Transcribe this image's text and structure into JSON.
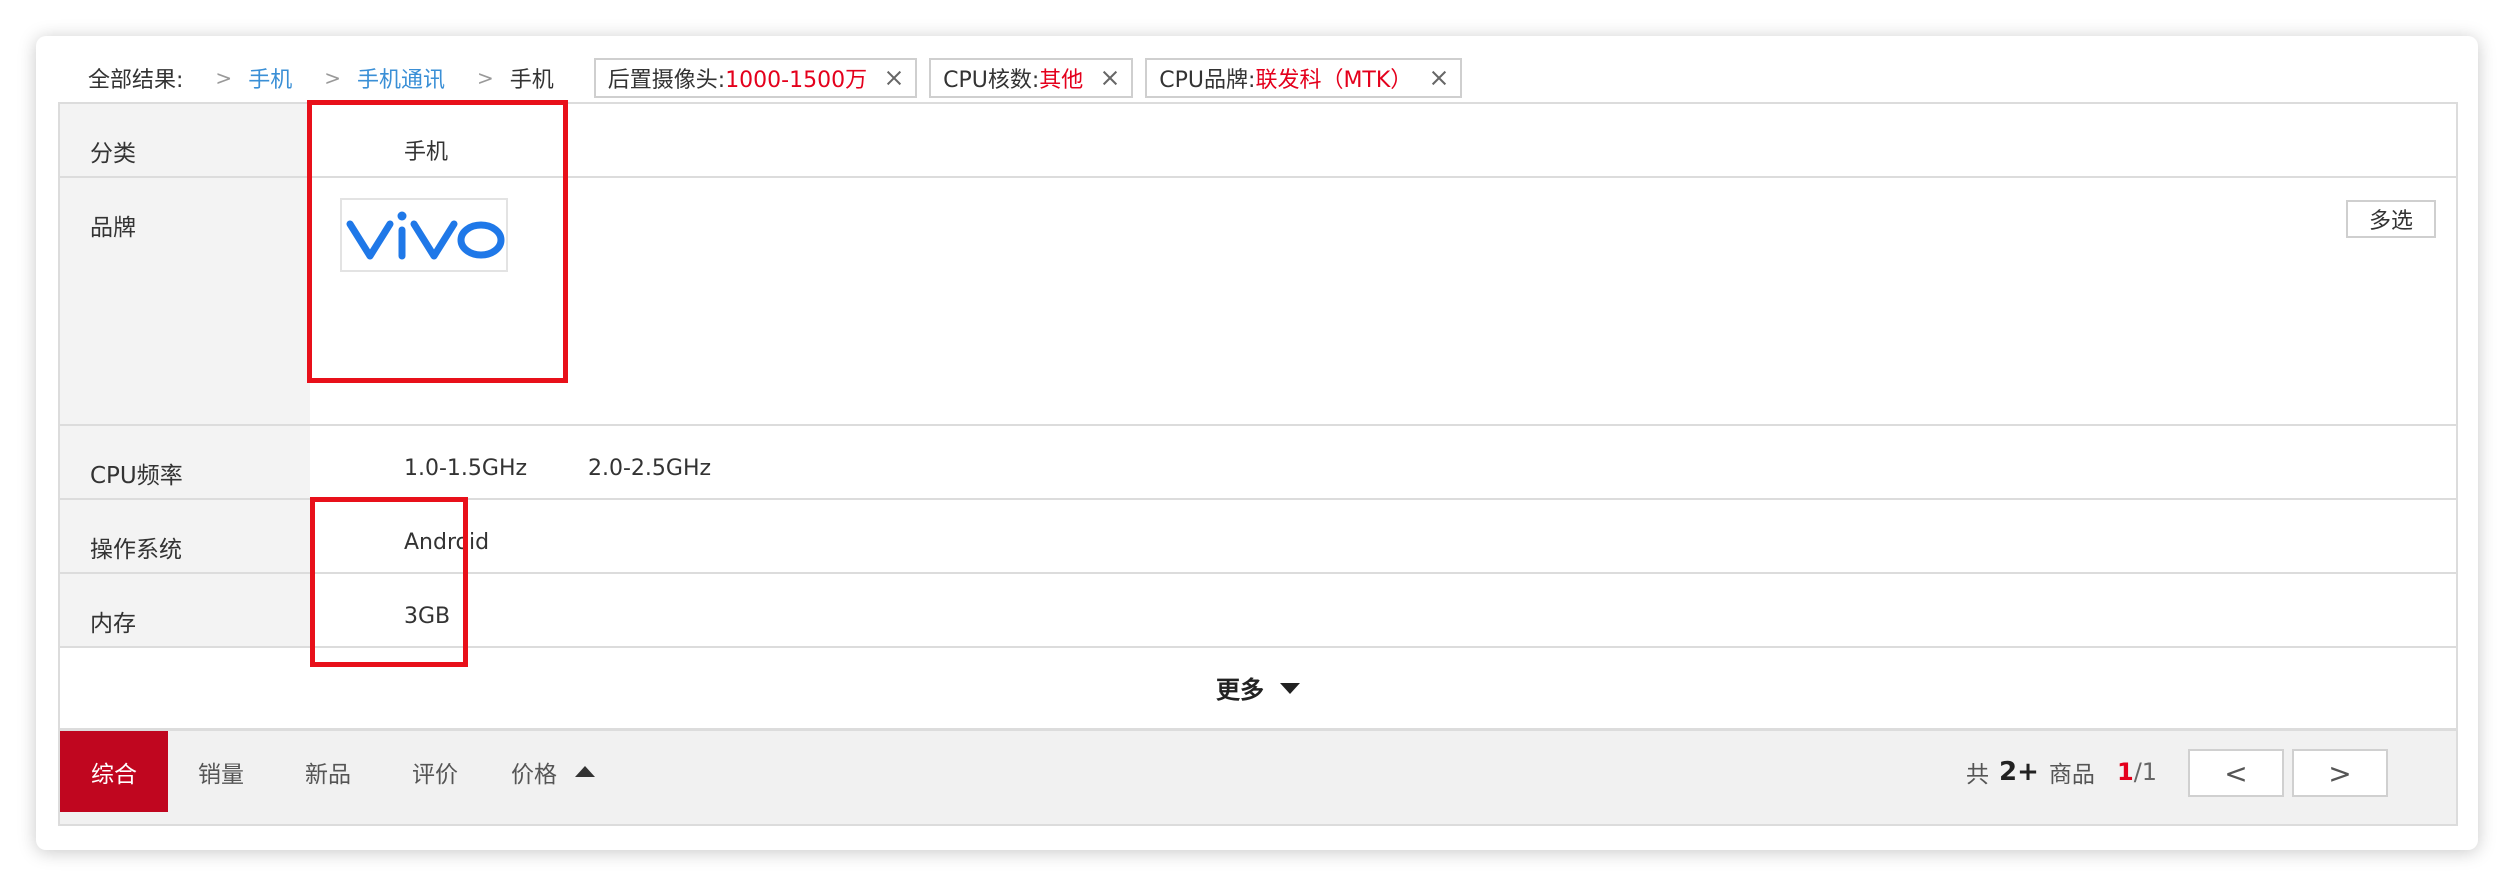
{
  "breadcrumb": {
    "lead": "全部结果:",
    "separator": ">",
    "items": [
      "手机",
      "手机通讯"
    ],
    "current": "手机"
  },
  "selected_filters": [
    {
      "key": "后置摄像头:",
      "value": "1000-1500万"
    },
    {
      "key": "CPU核数:",
      "value": "其他"
    },
    {
      "key": "CPU品牌:",
      "value": "联发科（MTK）"
    }
  ],
  "filters": {
    "category": {
      "label": "分类",
      "values": [
        "手机"
      ]
    },
    "brand": {
      "label": "品牌",
      "logo_text": "vivo",
      "logo_color": "#1f78e8",
      "multi_label": "多选"
    },
    "cpu_freq": {
      "label": "CPU频率",
      "values": [
        "1.0-1.5GHz",
        "2.0-2.5GHz"
      ]
    },
    "os": {
      "label": "操作系统",
      "values": [
        "Android"
      ]
    },
    "memory": {
      "label": "内存",
      "values": [
        "3GB"
      ]
    }
  },
  "more_label": "更多",
  "sort": {
    "items": [
      "综合",
      "销量",
      "新品",
      "评价",
      "价格"
    ],
    "active": "综合"
  },
  "results": {
    "prefix": "共",
    "count": "2+",
    "suffix": "商品"
  },
  "pagination": {
    "current": "1",
    "sep": "/",
    "total": "1",
    "prev": "<",
    "next": ">"
  },
  "colors": {
    "accent_red": "#c0061f",
    "link_blue": "#3a8fd6",
    "annotation": "#e8101a"
  }
}
